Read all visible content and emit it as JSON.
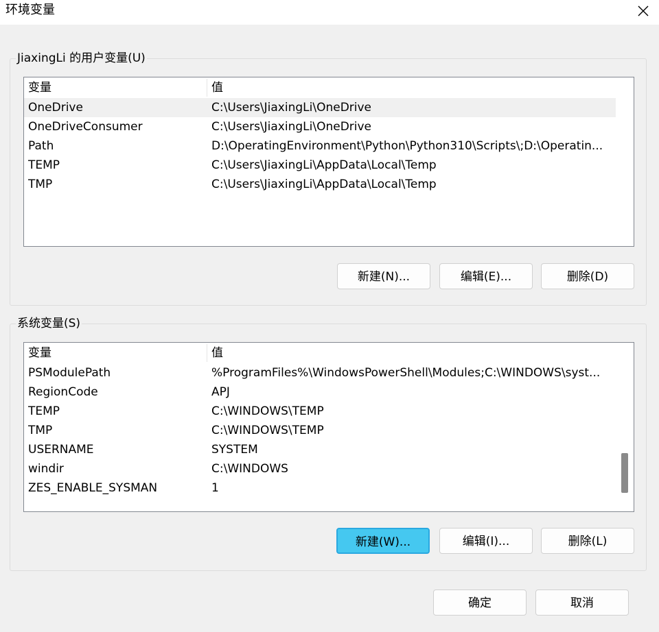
{
  "window": {
    "title": "环境变量",
    "close_icon": "close-icon"
  },
  "user_vars": {
    "legend": "JiaxingLi 的用户变量(U)",
    "columns": [
      "变量",
      "值"
    ],
    "rows": [
      {
        "name": "OneDrive",
        "value": "C:\\Users\\JiaxingLi\\OneDrive"
      },
      {
        "name": "OneDriveConsumer",
        "value": "C:\\Users\\JiaxingLi\\OneDrive"
      },
      {
        "name": "Path",
        "value": "D:\\OperatingEnvironment\\Python\\Python310\\Scripts\\;D:\\Operatin..."
      },
      {
        "name": "TEMP",
        "value": "C:\\Users\\JiaxingLi\\AppData\\Local\\Temp"
      },
      {
        "name": "TMP",
        "value": "C:\\Users\\JiaxingLi\\AppData\\Local\\Temp"
      }
    ],
    "buttons": {
      "new": "新建(N)...",
      "edit": "编辑(E)...",
      "delete": "删除(D)"
    }
  },
  "system_vars": {
    "legend": "系统变量(S)",
    "columns": [
      "变量",
      "值"
    ],
    "rows": [
      {
        "name": "PSModulePath",
        "value": "%ProgramFiles%\\WindowsPowerShell\\Modules;C:\\WINDOWS\\syst..."
      },
      {
        "name": "RegionCode",
        "value": "APJ"
      },
      {
        "name": "TEMP",
        "value": "C:\\WINDOWS\\TEMP"
      },
      {
        "name": "TMP",
        "value": "C:\\WINDOWS\\TEMP"
      },
      {
        "name": "USERNAME",
        "value": "SYSTEM"
      },
      {
        "name": "windir",
        "value": "C:\\WINDOWS"
      },
      {
        "name": "ZES_ENABLE_SYSMAN",
        "value": "1"
      }
    ],
    "buttons": {
      "new": "新建(W)...",
      "edit": "编辑(I)...",
      "delete": "删除(L)"
    }
  },
  "footer": {
    "ok": "确定",
    "cancel": "取消"
  },
  "colors": {
    "highlight": "#45c8f0",
    "selected_row": "#f0f0f0"
  }
}
